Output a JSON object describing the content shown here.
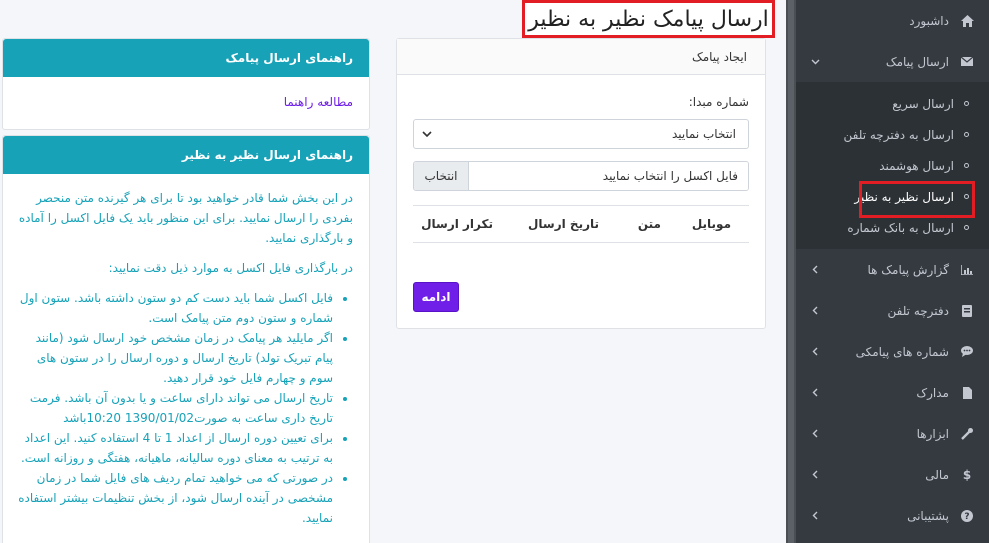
{
  "page_title": "ارسال پیامک نظیر به نظیر",
  "sidebar": {
    "dashboard": "داشبورد",
    "send_sms": "ارسال پیامک",
    "submenu": [
      "ارسال سریع",
      "ارسال به دفترچه تلفن",
      "ارسال هوشمند",
      "ارسال نظیر به نظیر",
      "ارسال به بانک شماره"
    ],
    "items": [
      "گزارش پیامک ها",
      "دفترچه تلفن",
      "شماره های پیامکی",
      "مدارک",
      "ابزارها",
      "مالی",
      "پشتیبانی"
    ]
  },
  "form": {
    "card_title": "ایجاد پیامک",
    "origin_label": "شماره مبدا:",
    "origin_select": "انتخاب نمایید",
    "file_placeholder": "فایل اکسل را انتخاب نمایید",
    "file_button": "انتخاب",
    "table_headers": [
      "موبایل",
      "متن",
      "تاریخ ارسال",
      "تکرار ارسال"
    ],
    "continue_button": "ادامه"
  },
  "guide": {
    "title": "راهنمای ارسال پیامک",
    "link": "مطالعه راهنما"
  },
  "p2p_guide": {
    "title": "راهنمای ارسال نظیر به نظیر",
    "intro": "در این بخش شما قادر خواهید بود تا برای هر گیرنده متن منحصر بفردی را ارسال نمایید. برای این منظور باید یک فایل اکسل را آماده و بارگذاری نمایید.",
    "upload_note": "در بارگذاری فایل اکسل به موارد ذیل دقت نمایید:",
    "bullets": [
      "فایل اکسل شما باید دست کم دو ستون داشته باشد. ستون اول شماره و ستون دوم متن پیامک است.",
      "اگر مایلید هر پیامک در زمان مشخص خود ارسال شود (مانند پیام تبریک تولد) تاریخ ارسال و دوره ارسال را در ستون های سوم و چهارم فایل خود قرار دهید.",
      "تاریخ ارسال می تواند دارای ساعت و یا بدون آن باشد. فرمت تاریخ داری ساعت به صورت1390/01/02 10:20باشد",
      "برای تعیین دوره ارسال از اعداد 1 تا 4 استفاده کنید. این اعداد به ترتیب به معنای دوره سالیانه، ماهیانه، هفتگی و روزانه است.",
      "در صورتی که می خواهید تمام ردیف های فایل شما در زمان مشخصی در آینده ارسال شود، از بخش تنظیمات بیشتر استفاده نمایید."
    ]
  }
}
